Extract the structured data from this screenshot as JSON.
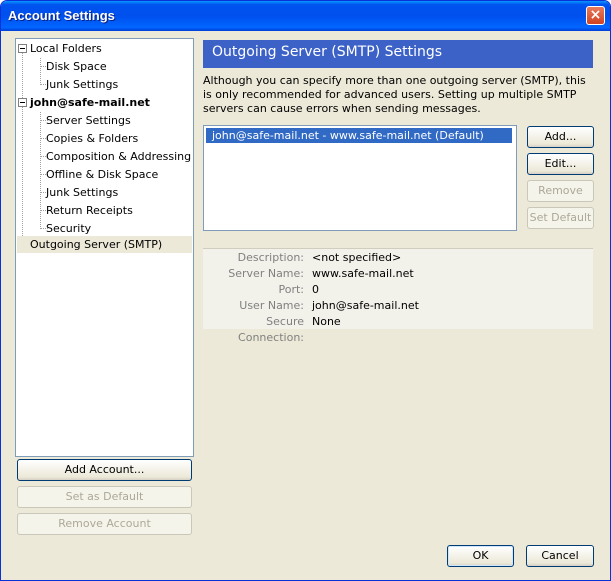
{
  "window": {
    "title": "Account Settings",
    "close_label": "×"
  },
  "tree": {
    "items": [
      {
        "label": "Local Folders"
      },
      {
        "label": "Disk Space"
      },
      {
        "label": "Junk Settings"
      },
      {
        "label": "john@safe-mail.net"
      },
      {
        "label": "Server Settings"
      },
      {
        "label": "Copies & Folders"
      },
      {
        "label": "Composition & Addressing"
      },
      {
        "label": "Offline & Disk Space"
      },
      {
        "label": "Junk Settings"
      },
      {
        "label": "Return Receipts"
      },
      {
        "label": "Security"
      },
      {
        "label": "Outgoing Server (SMTP)"
      }
    ]
  },
  "left_buttons": {
    "add_account": "Add Account...",
    "set_default": "Set as Default",
    "remove_account": "Remove Account"
  },
  "panel": {
    "title": "Outgoing Server (SMTP) Settings",
    "description": "Although you can specify more than one outgoing server (SMTP), this is only recommended for advanced users. Setting up multiple SMTP servers can cause errors when sending messages.",
    "servers": [
      "john@safe-mail.net - www.safe-mail.net (Default)"
    ],
    "buttons": {
      "add": "Add...",
      "edit": "Edit...",
      "remove": "Remove",
      "set_default": "Set Default"
    },
    "details": {
      "description_label": "Description:",
      "description_value": "<not specified>",
      "server_name_label": "Server Name:",
      "server_name_value": "www.safe-mail.net",
      "port_label": "Port:",
      "port_value": "0",
      "user_name_label": "User Name:",
      "user_name_value": "john@safe-mail.net",
      "secure_label": "Secure Connection:",
      "secure_value": "None"
    }
  },
  "footer": {
    "ok": "OK",
    "cancel": "Cancel"
  }
}
